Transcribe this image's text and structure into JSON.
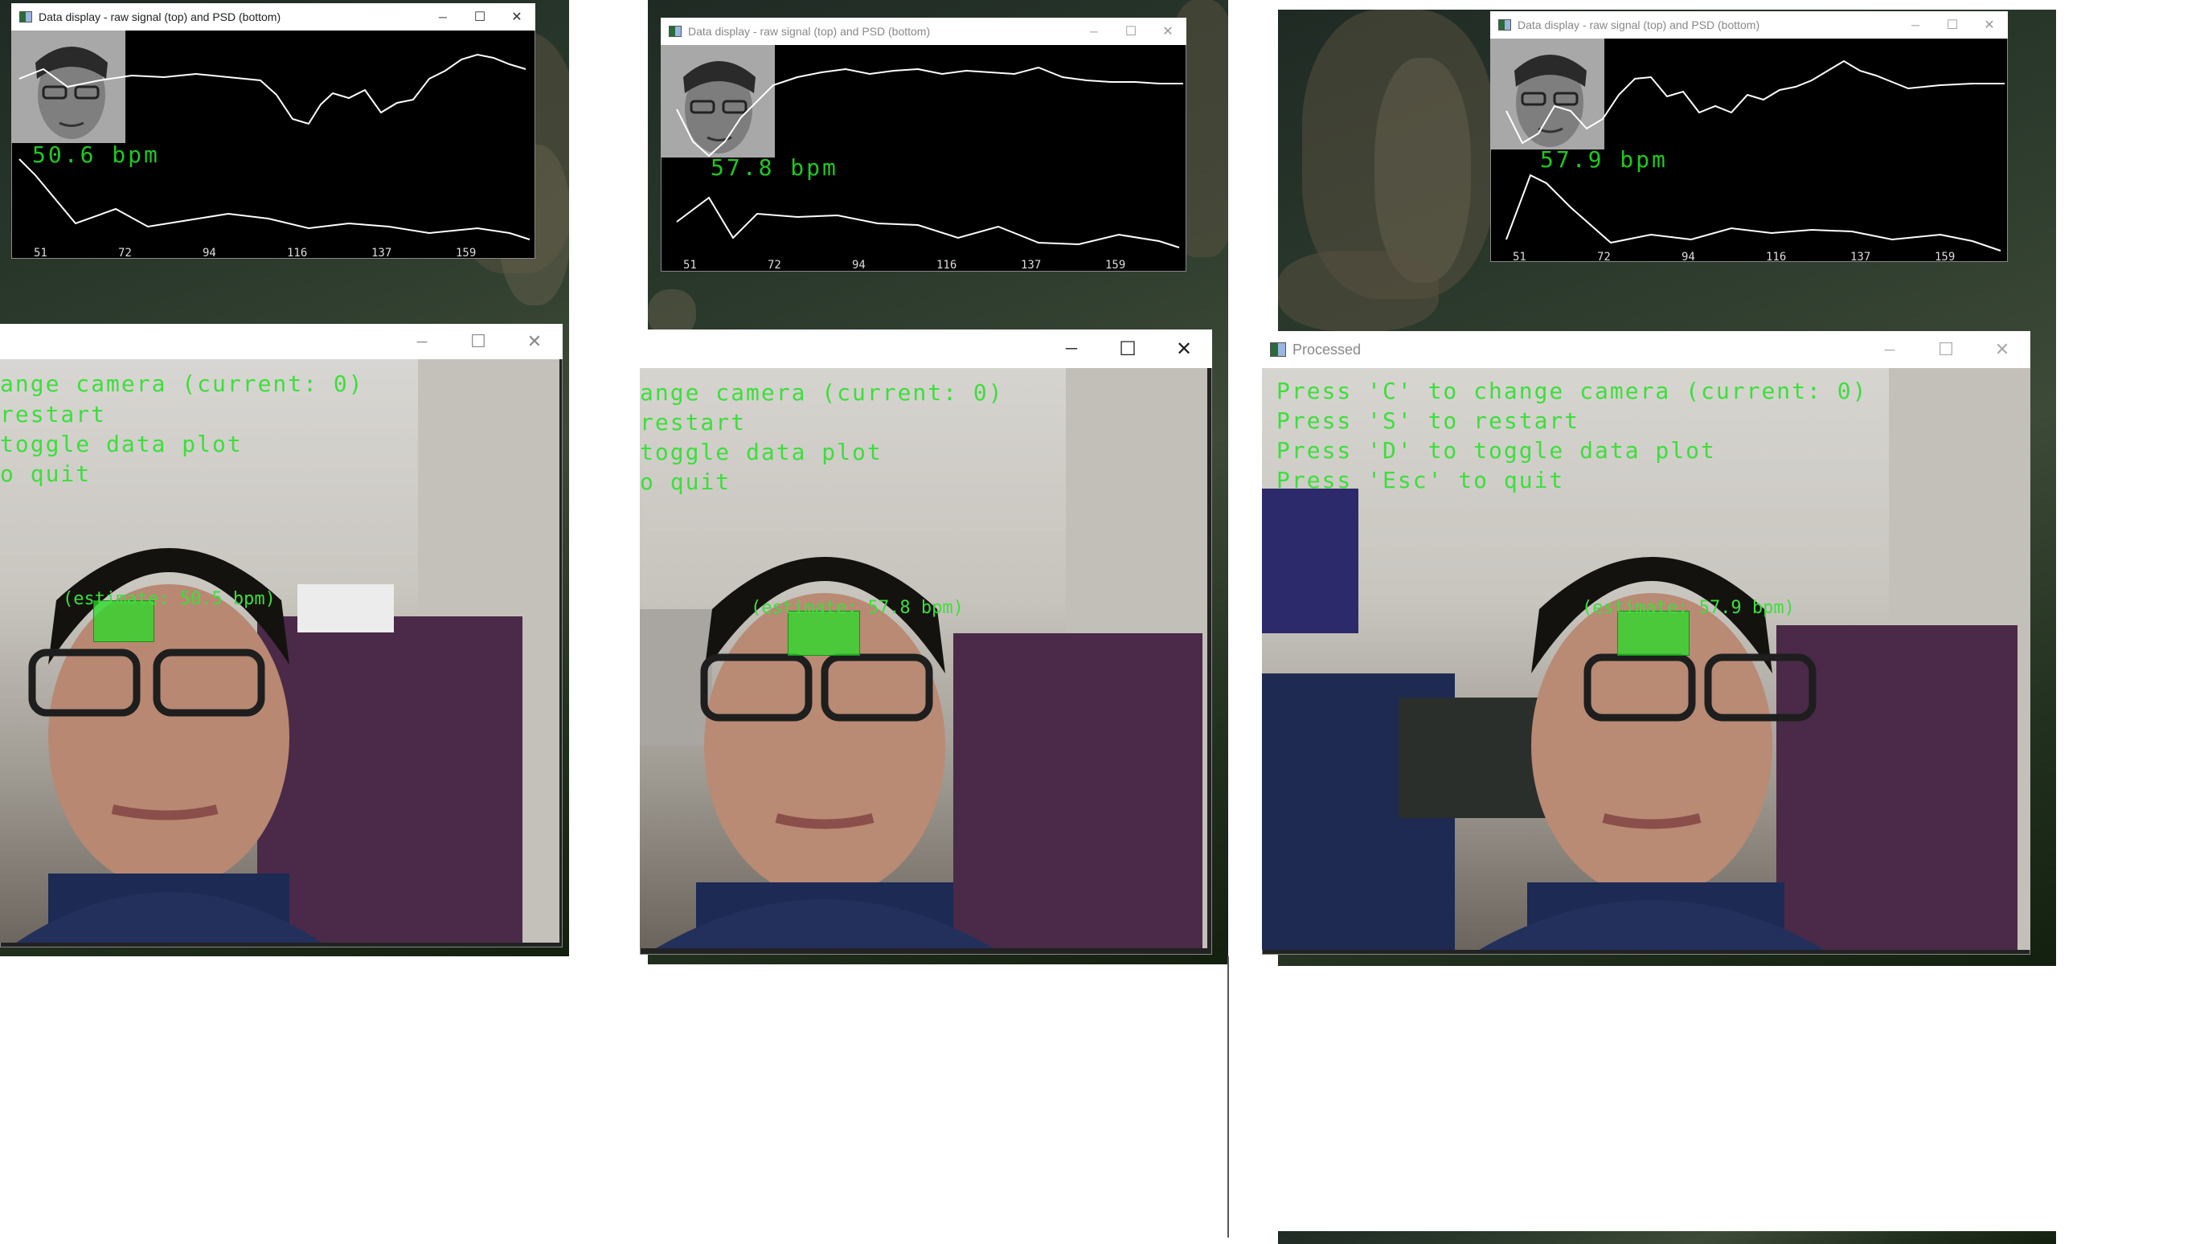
{
  "data_window_title": "Data display - raw signal (top) and PSD (bottom)",
  "processed_window_title": "Processed",
  "freq_ticks": [
    "51",
    "72",
    "94",
    "116",
    "137",
    "159"
  ],
  "panels": [
    {
      "bpm_label": "50.6  bpm",
      "estimate": "(estimate: 50.5 bpm)"
    },
    {
      "bpm_label": "57.8  bpm",
      "estimate": "(estimate: 57.8 bpm)"
    },
    {
      "bpm_label": "57.9  bpm",
      "estimate": "(estimate: 57.9 bpm)"
    }
  ],
  "instructions_full": {
    "line1": "Press 'C' to change camera (current: 0)",
    "line2": "Press 'S' to restart",
    "line3": "Press 'D' to toggle data plot",
    "line4": "Press 'Esc' to quit"
  },
  "instructions_clip1": {
    "line1": "ange camera (current: 0)",
    "line2": "restart",
    "line3": "toggle data plot",
    "line4": "o quit"
  },
  "instructions_clip2": {
    "line1": "ange camera (current: 0)",
    "line2": "restart",
    "line3": "toggle data plot",
    "line4": "o quit"
  },
  "icons": {
    "minimize": "─",
    "maximize": "☐",
    "close": "✕"
  },
  "colors": {
    "overlay_green": "#3dde3d",
    "roi_green": "#28dc28",
    "plot_line": "#ffffff"
  }
}
